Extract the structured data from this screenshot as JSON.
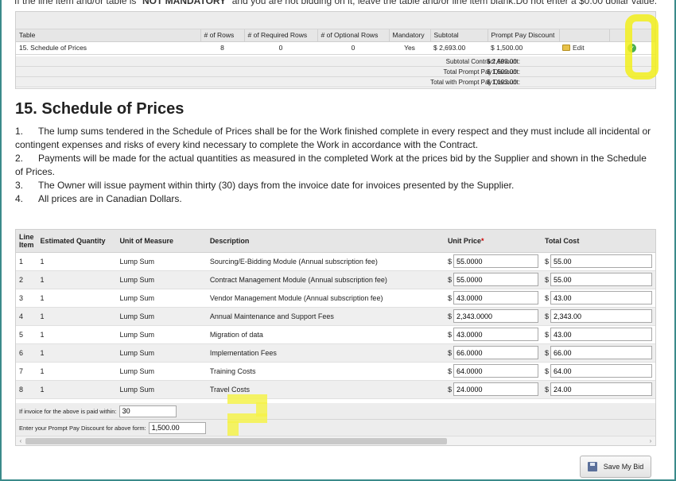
{
  "top_cut": {
    "text_a": "If the line item and/or table is",
    "text_bold": "NOT MANDATORY",
    "text_b": "and you are not bidding on it, leave the table and/or line item blank.Do not enter a $0.00 dollar value."
  },
  "summary": {
    "headers": [
      "Table",
      "# of Rows",
      "# of Required Rows",
      "# of Optional Rows",
      "Mandatory",
      "Subtotal",
      "Prompt Pay Discount",
      "",
      ""
    ],
    "row": {
      "table": "15. Schedule of Prices",
      "rows": "8",
      "required": "0",
      "optional": "0",
      "mandatory": "Yes",
      "subtotal": "$ 2,693.00",
      "discount": "$ 1,500.00",
      "edit_label": "Edit"
    },
    "totals": [
      {
        "label": "Subtotal Contract Amount:",
        "value": "$ 2,693.00"
      },
      {
        "label": "Total Prompt Pay Discount:",
        "value": "$ 1,500.00"
      },
      {
        "label": "Total with Prompt Pay Discount:",
        "value": "$ 1,193.00"
      }
    ]
  },
  "section": {
    "title": "15. Schedule of Prices",
    "notes": [
      {
        "num": "1.",
        "text": "The lump sums tendered in the Schedule of Prices shall be for the Work finished complete in  every respect and they must include all incidental or contingent expenses and risks of every kind  necessary to complete the Work in accordance with the Contract."
      },
      {
        "num": "2.",
        "text": "Payments will be made for the actual quantities as measured in the completed Work at the prices bid by the Supplier and shown in the Schedule of Prices."
      },
      {
        "num": "3.",
        "text": "The Owner will issue payment within thirty (30) days from the invoice date for invoices presented by the Supplier."
      },
      {
        "num": "4.",
        "text": "All prices are in Canadian Dollars."
      }
    ]
  },
  "grid": {
    "headers": {
      "line_item_a": "Line",
      "line_item_b": "Item",
      "qty": "Estimated Quantity",
      "uom": "Unit of Measure",
      "desc": "Description",
      "unit_price": "Unit Price",
      "required_mark": "*",
      "total": "Total Cost"
    },
    "currency": "$",
    "rows": [
      {
        "item": "1",
        "qty": "1",
        "uom": "Lump Sum",
        "desc": "Sourcing/E-Bidding Module (Annual subscription fee)",
        "unit_price": "55.0000",
        "total": "55.00"
      },
      {
        "item": "2",
        "qty": "1",
        "uom": "Lump Sum",
        "desc": "Contract Management Module (Annual subscription fee)",
        "unit_price": "55.0000",
        "total": "55.00"
      },
      {
        "item": "3",
        "qty": "1",
        "uom": "Lump Sum",
        "desc": "Vendor Management Module (Annual subscription fee)",
        "unit_price": "43.0000",
        "total": "43.00"
      },
      {
        "item": "4",
        "qty": "1",
        "uom": "Lump Sum",
        "desc": "Annual Maintenance and Support Fees",
        "unit_price": "2,343.0000",
        "total": "2,343.00"
      },
      {
        "item": "5",
        "qty": "1",
        "uom": "Lump Sum",
        "desc": "Migration of data",
        "unit_price": "43.0000",
        "total": "43.00"
      },
      {
        "item": "6",
        "qty": "1",
        "uom": "Lump Sum",
        "desc": "Implementation Fees",
        "unit_price": "66.0000",
        "total": "66.00"
      },
      {
        "item": "7",
        "qty": "1",
        "uom": "Lump Sum",
        "desc": "Training Costs",
        "unit_price": "64.0000",
        "total": "64.00"
      },
      {
        "item": "8",
        "qty": "1",
        "uom": "Lump Sum",
        "desc": "Travel Costs",
        "unit_price": "24.0000",
        "total": "24.00"
      }
    ],
    "invoice_label": "If invoice for the above is paid within:",
    "invoice_days": "30",
    "discount_label": "Enter your Prompt Pay Discount for above form:",
    "discount_value": "1,500.00"
  },
  "save_button": {
    "label": "Save My Bid"
  },
  "colors": {
    "highlight": "#f2ef1c",
    "check": "#4caf50",
    "required": "#cc0000"
  }
}
